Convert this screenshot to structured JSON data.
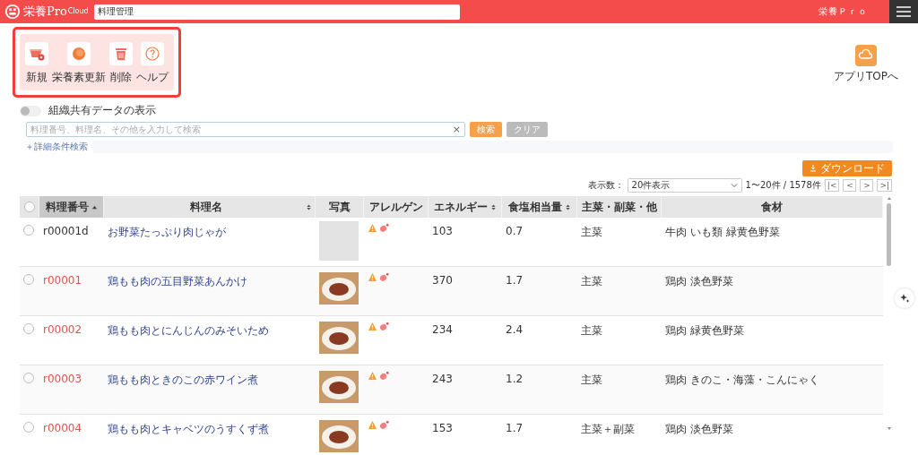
{
  "app_bar": {
    "logo_text": "栄養Pro",
    "logo_superscript": "Cloud",
    "page_title": "料理管理",
    "user_label": "栄養Ｐｒｏ"
  },
  "toolbar": [
    {
      "label": "新規",
      "kind": "new"
    },
    {
      "label": "栄養素更新",
      "kind": "update"
    },
    {
      "label": "削除",
      "kind": "delete"
    },
    {
      "label": "ヘルプ",
      "kind": "help"
    }
  ],
  "app_top": {
    "label": "アプリTOPへ"
  },
  "shared_toggle": {
    "label": "組織共有データの表示",
    "on": false
  },
  "search": {
    "placeholder": "料理番号、料理名、その他を入力して検索",
    "clear_icon": "×",
    "search_button": "検索",
    "clear_button": "クリア"
  },
  "advanced_search": "＋詳細条件検索",
  "download_button": "ダウンロード",
  "pager": {
    "label": "表示数：",
    "page_size": "20件表示",
    "range": "1〜20件 / 1578件",
    "buttons": [
      "|<",
      "<",
      ">",
      ">|"
    ]
  },
  "table": {
    "all_selected": false,
    "columns": [
      {
        "label": "料理番号",
        "sortable": true,
        "sorted": true
      },
      {
        "label": "料理名",
        "sortable": true,
        "sorted": false
      },
      {
        "label": "写真"
      },
      {
        "label": "アレルゲン"
      },
      {
        "label": "エネルギー",
        "sortable": true,
        "sorted": false
      },
      {
        "label": "食塩相当量",
        "sortable": true,
        "sorted": false
      },
      {
        "label": "主菜・副菜・他"
      },
      {
        "label": "食材"
      }
    ],
    "rows": [
      {
        "selected": false,
        "code": "r00001d",
        "color": "#333333",
        "name": "お野菜たっぷり肉じゃが",
        "has_photo": false,
        "energy": "103",
        "salt": "0.7",
        "category": "主菜",
        "ingredients": "牛肉 いも類 緑黄色野菜"
      },
      {
        "selected": false,
        "code": "r00001",
        "color": "#e0534f",
        "name": "鶏もも肉の五目野菜あんかけ",
        "has_photo": true,
        "energy": "370",
        "salt": "1.7",
        "category": "主菜",
        "ingredients": "鶏肉 淡色野菜"
      },
      {
        "selected": false,
        "code": "r00002",
        "color": "#e0534f",
        "name": "鶏もも肉とにんじんのみそいため",
        "has_photo": true,
        "energy": "234",
        "salt": "2.4",
        "category": "主菜",
        "ingredients": "鶏肉 緑黄色野菜"
      },
      {
        "selected": false,
        "code": "r00003",
        "color": "#e0534f",
        "name": "鶏もも肉ときのこの赤ワイン煮",
        "has_photo": true,
        "energy": "243",
        "salt": "1.2",
        "category": "主菜",
        "ingredients": "鶏肉 きのこ・海藻・こんにゃく"
      },
      {
        "selected": false,
        "code": "r00004",
        "color": "#e0534f",
        "name": "鶏もも肉とキャベツのうすくず煮",
        "has_photo": true,
        "energy": "153",
        "salt": "1.7",
        "category": "主菜＋副菜",
        "ingredients": "鶏肉 淡色野菜"
      }
    ]
  }
}
